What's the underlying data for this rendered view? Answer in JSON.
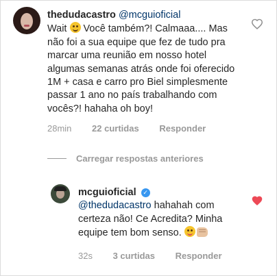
{
  "comment1": {
    "username": "thedudacastro",
    "verified": true,
    "mention": "@mcguioficial",
    "text_a": "Wait",
    "text_b": "Você também?! Calmaaa.... Mas não foi a sua equipe que fez de tudo pra marcar uma reunião em nosso hotel algumas semanas atrás onde foi oferecido 1M + casa e carro pro Biel simplesmente passar 1 ano no país trabalhando com vocês?! hahaha oh boy!",
    "emoji": "grinning-sweat-emoji",
    "time": "28min",
    "likes": "22 curtidas",
    "reply": "Responder",
    "liked": false
  },
  "load_more": "Carregar respostas anteriores",
  "comment2": {
    "username": "mcguioficial",
    "verified": true,
    "mention": "@thedudacastro",
    "text_a": "hahahah com certeza não! Ce Acredita? Minha equipe tem bom senso.",
    "emoji1": "winking-tongue-emoji",
    "emoji2": "fist-emoji",
    "time": "32s",
    "likes": "3 curtidas",
    "reply": "Responder",
    "liked": true
  },
  "colors": {
    "text": "#262626",
    "meta": "#999999",
    "mention": "#003569",
    "verified": "#3897f0",
    "heart_active": "#ed4956",
    "heart_outline": "#8e8e8e"
  }
}
